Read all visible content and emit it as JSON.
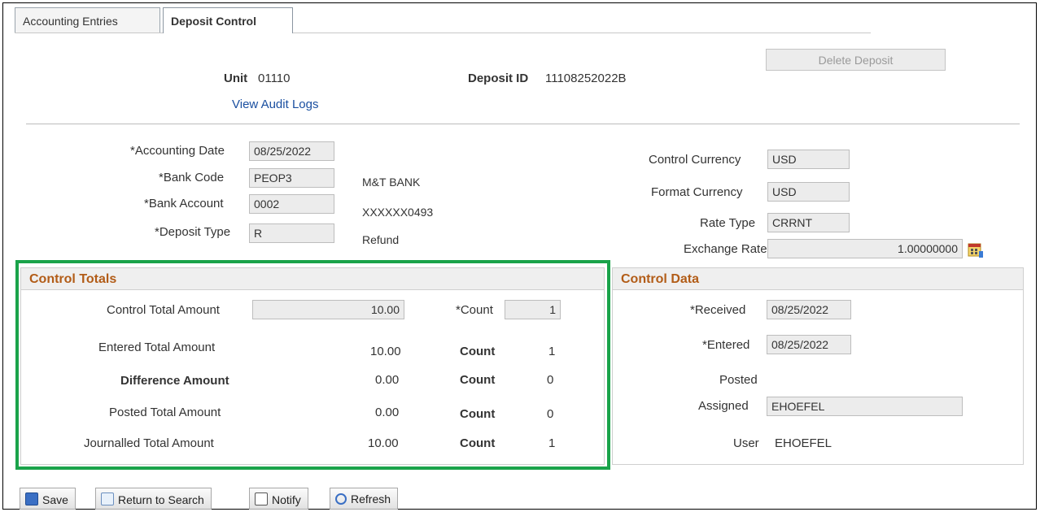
{
  "tabs": [
    {
      "label": "Accounting Entries",
      "active": false
    },
    {
      "label": "Deposit Control",
      "active": true
    }
  ],
  "header": {
    "unit_label": "Unit",
    "unit_value": "01110",
    "deposit_id_label": "Deposit ID",
    "deposit_id_value": "11108252022B",
    "delete_button": "Delete Deposit",
    "audit_link": "View Audit Logs"
  },
  "left_fields": {
    "accounting_date": {
      "label": "*Accounting Date",
      "value": "08/25/2022"
    },
    "bank_code": {
      "label": "*Bank Code",
      "value": "PEOP3",
      "desc": "M&T BANK"
    },
    "bank_account": {
      "label": "*Bank Account",
      "value": "0002",
      "desc": "XXXXXX0493"
    },
    "deposit_type": {
      "label": "*Deposit Type",
      "value": "R",
      "desc": "Refund"
    }
  },
  "right_fields": {
    "control_currency": {
      "label": "Control Currency",
      "value": "USD"
    },
    "format_currency": {
      "label": "Format Currency",
      "value": "USD"
    },
    "rate_type": {
      "label": "Rate Type",
      "value": "CRRNT"
    },
    "exchange_rate": {
      "label": "Exchange Rate",
      "value": "1.00000000"
    }
  },
  "control_totals": {
    "title": "Control Totals",
    "rows": [
      {
        "label": "Control Total Amount",
        "amount": "10.00",
        "count_label": "*Count",
        "count": "1"
      },
      {
        "label": "Entered Total Amount",
        "amount": "10.00",
        "count_label": "Count",
        "count": "1"
      },
      {
        "label": "Difference Amount",
        "amount": "0.00",
        "count_label": "Count",
        "count": "0"
      },
      {
        "label": "Posted Total Amount",
        "amount": "0.00",
        "count_label": "Count",
        "count": "0"
      },
      {
        "label": "Journalled Total Amount",
        "amount": "10.00",
        "count_label": "Count",
        "count": "1"
      }
    ]
  },
  "control_data": {
    "title": "Control Data",
    "received": {
      "label": "*Received",
      "value": "08/25/2022"
    },
    "entered": {
      "label": "*Entered",
      "value": "08/25/2022"
    },
    "posted": {
      "label": "Posted"
    },
    "assigned": {
      "label": "Assigned",
      "value": "EHOEFEL"
    },
    "user": {
      "label": "User",
      "value": "EHOEFEL"
    }
  },
  "toolbar": {
    "save": "Save",
    "return_to_search": "Return to Search",
    "notify": "Notify",
    "refresh": "Refresh"
  },
  "colors": {
    "highlight": "#1aa34a",
    "group_title": "#b25c17",
    "link": "#1a4fa0"
  },
  "icons": [
    "calendar-icon",
    "save-icon",
    "search-icon",
    "notify-icon",
    "refresh-icon"
  ]
}
